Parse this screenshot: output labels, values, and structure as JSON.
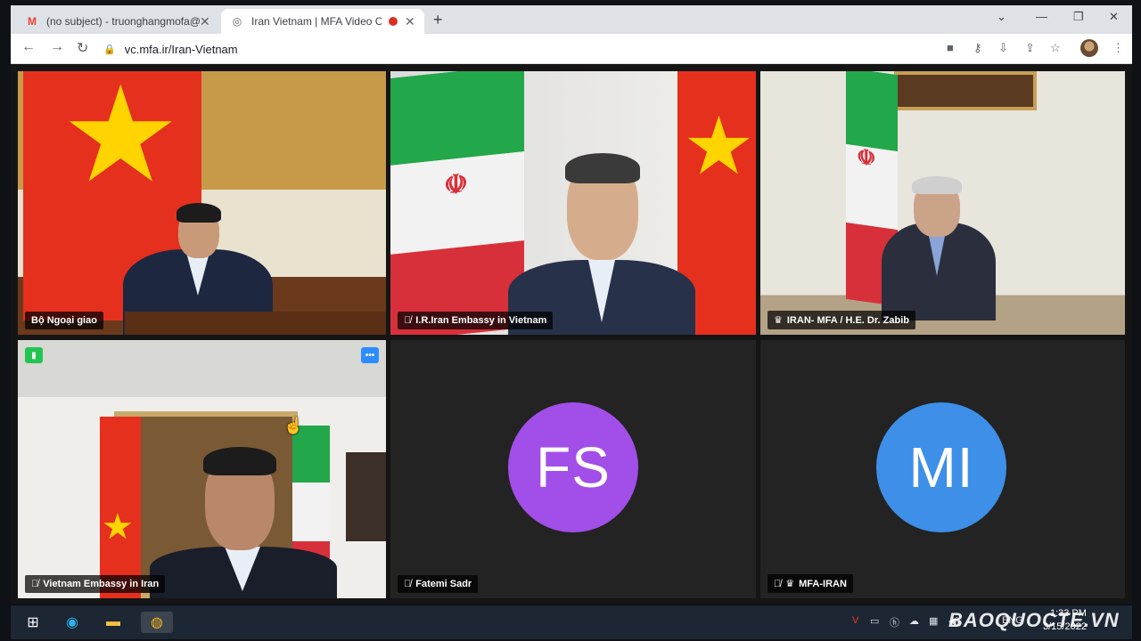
{
  "browser": {
    "tabs": [
      {
        "title": "(no subject) - truonghangmofa@",
        "icon": "gmail-icon"
      },
      {
        "title": "Iran Vietnam | MFA Video Co",
        "icon": "mfa-icon",
        "recording": true
      }
    ],
    "url": "vc.mfa.ir/Iran-Vietnam"
  },
  "participants": [
    {
      "name": "Bộ Ngoại giao",
      "muted": false,
      "host": false,
      "video": true,
      "active_speaker": true
    },
    {
      "name": "I.R.Iran Embassy in Vietnam",
      "muted": true,
      "host": false,
      "video": true
    },
    {
      "name": "IRAN- MFA / H.E. Dr. Zabib",
      "muted": false,
      "host": true,
      "video": true
    },
    {
      "name": "Vietnam Embassy in Iran",
      "muted": true,
      "host": false,
      "video": true
    },
    {
      "name": "Fatemi Sadr",
      "muted": true,
      "host": false,
      "video": false,
      "initials": "FS",
      "avatar_color": "#a24ee8"
    },
    {
      "name": "MFA-IRAN",
      "muted": true,
      "host": true,
      "video": false,
      "initials": "MI",
      "avatar_color": "#3d8fe8"
    }
  ],
  "taskbar": {
    "apps": [
      "windows-start-icon",
      "edge-icon",
      "file-explorer-icon",
      "chrome-icon"
    ],
    "time": "1:33 PM",
    "date": "3/15/2022",
    "lang": "ENG"
  },
  "watermark": "BAOQUOCTE.VN"
}
